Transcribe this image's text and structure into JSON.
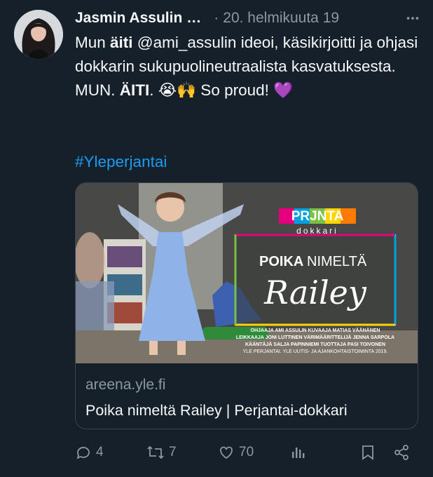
{
  "tweet": {
    "author": "Jasmin Assulin",
    "author_suffix": "…",
    "separator": "·",
    "date": "20. helmikuuta 19",
    "text": {
      "p1": "Mun ",
      "b1": "äiti",
      "p2": " @ami_assulin ideoi, käsikirjoitti ja ohjasi dokkarin sukupuolineutraalista kasvatuksesta. MUN. ",
      "b2": "ÄITI",
      "p3": ". 😭🙌 So proud! 💜"
    },
    "hashtag": "#Yleperjantai"
  },
  "card": {
    "image": {
      "brand_top": "PRJNTA",
      "brand_sub": "dokkari",
      "title_bold": "POIKA",
      "title_rest": "NIMELTÄ",
      "script_name": "Railey",
      "credits_1": "OHJAAJA AMI ASSULIN KUVAAJA MATIAS VÄÄNÄNEN",
      "credits_2": "LEIKKAAJA JONI LUTTINEN VÄRIMÄÄRITTELIJÄ JENNA SARPOLA",
      "credits_3": "KÄÄNTÄJÄ SALJA PAPINNIEMI TUOTTAJA PASI TOIVONEN",
      "credits_4": "YLE PERJANTAI. YLE UUTIS- JA AJANKOHTAISTOIMINTA 2019."
    },
    "domain": "areena.yle.fi",
    "title": "Poika nimeltä Railey | Perjantai-dokkari"
  },
  "actions": {
    "reply_count": "4",
    "retweet_count": "7",
    "like_count": "70"
  },
  "icons": [
    "more-icon",
    "reply-icon",
    "retweet-icon",
    "like-icon",
    "views-icon",
    "bookmark-icon",
    "share-icon"
  ],
  "colors": {
    "background": "#15202b",
    "accent": "#1d9bf0",
    "muted": "#8b98a5"
  }
}
